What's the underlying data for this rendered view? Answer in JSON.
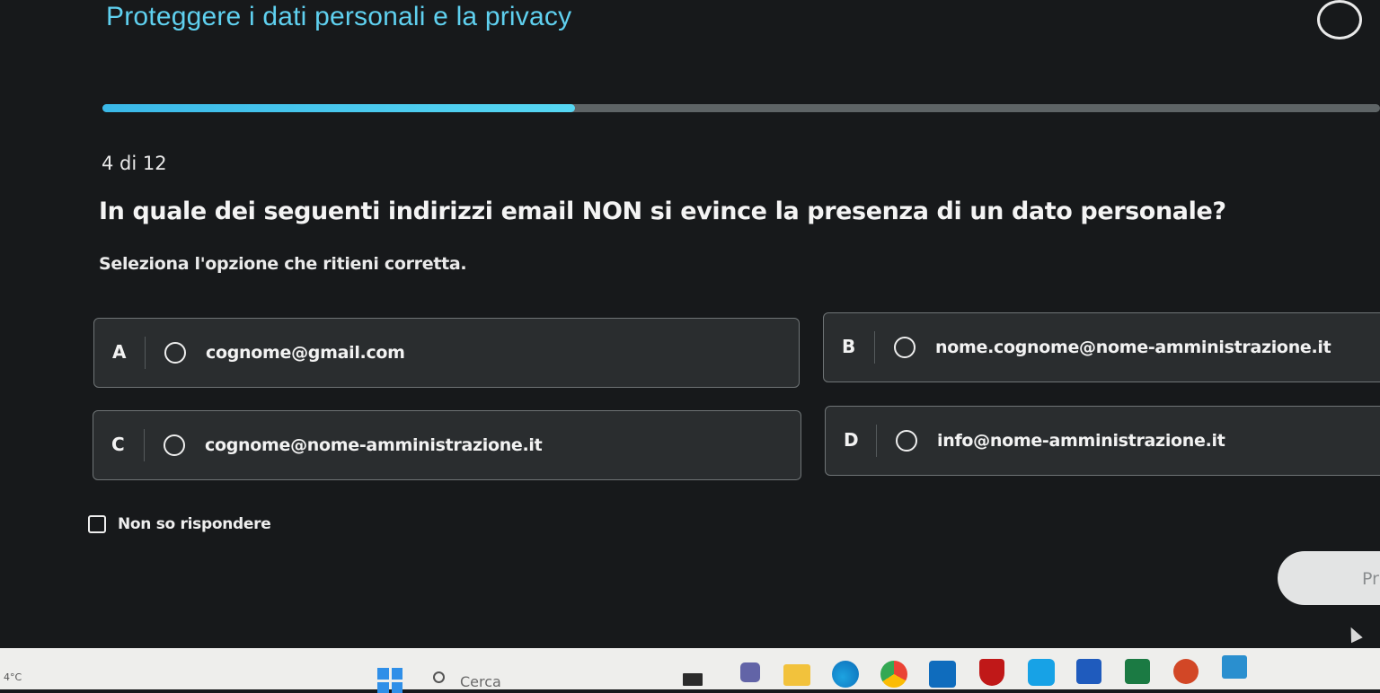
{
  "quiz": {
    "title": "Proteggere i dati personali e la privacy",
    "progress_fraction": 0.37,
    "counter": "4 di 12",
    "question": "In quale dei seguenti indirizzi email NON si evince la presenza di un dato personale?",
    "instruction": "Seleziona l'opzione che ritieni corretta.",
    "options": [
      {
        "letter": "A",
        "text": "cognome@gmail.com"
      },
      {
        "letter": "B",
        "text": "nome.cognome@nome-amministrazione.it"
      },
      {
        "letter": "C",
        "text": "cognome@nome-amministrazione.it"
      },
      {
        "letter": "D",
        "text": "info@nome-amministrazione.it"
      }
    ],
    "dont_know_label": "Non so rispondere",
    "next_button_label": "Pr"
  },
  "taskbar": {
    "weather": "4°C",
    "search_placeholder": "Cerca",
    "icons": [
      "windows-start-icon",
      "search-icon",
      "teams-icon",
      "file-explorer-icon",
      "edge-icon",
      "chrome-icon",
      "outlook-icon",
      "mcafee-icon",
      "cortana-icon",
      "word-icon",
      "excel-icon",
      "powerpoint-icon",
      "calendar-icon"
    ]
  },
  "colors": {
    "accent": "#5fd0ef",
    "background": "#17191b",
    "option_bg": "#2a2d2f"
  }
}
